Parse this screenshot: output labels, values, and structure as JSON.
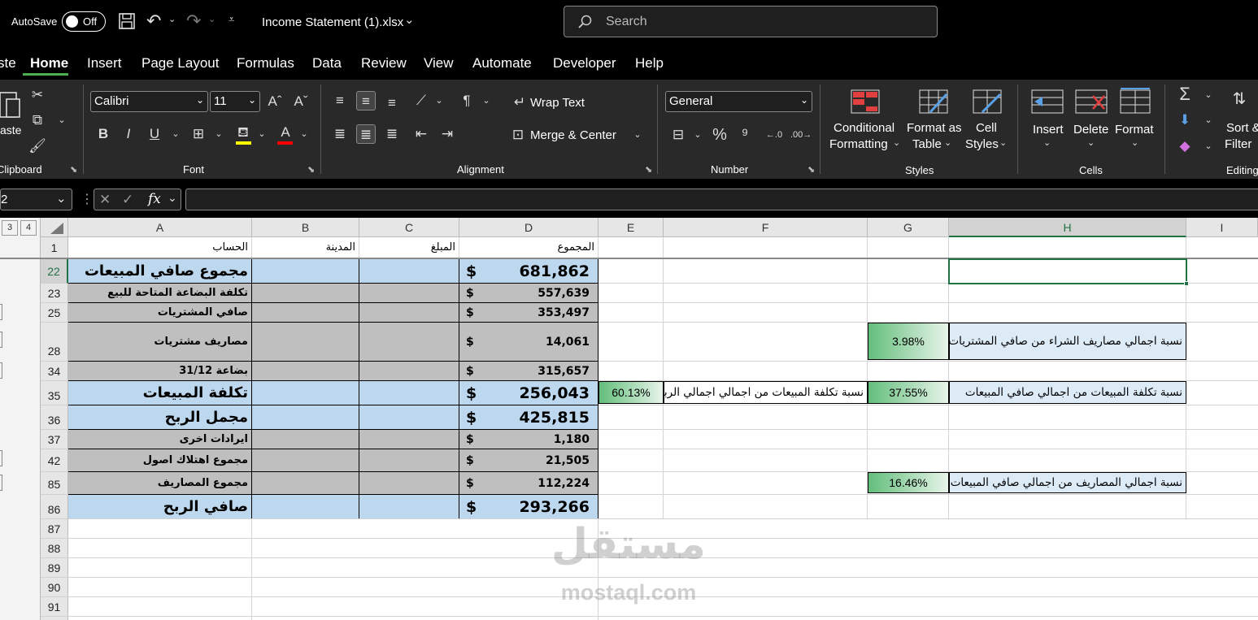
{
  "title_bar": {
    "autosave_label": "AutoSave",
    "autosave_state": "Off",
    "file_name": "Income Statement (1).xlsx",
    "search_placeholder": "Search"
  },
  "ribbon_tabs": [
    "ste",
    "Home",
    "Insert",
    "Page Layout",
    "Formulas",
    "Data",
    "Review",
    "View",
    "Automate",
    "Developer",
    "Help"
  ],
  "ribbon": {
    "clipboard": {
      "paste_label": "aste",
      "group_label": "Clipboard"
    },
    "font": {
      "name": "Calibri",
      "size": "11",
      "group_label": "Font"
    },
    "alignment": {
      "wrap_text": "Wrap Text",
      "merge_center": "Merge & Center",
      "group_label": "Alignment"
    },
    "number": {
      "format": "General",
      "group_label": "Number"
    },
    "styles": {
      "conditional_1": "Conditional",
      "conditional_2": "Formatting",
      "format_table_1": "Format as",
      "format_table_2": "Table",
      "cell_styles_1": "Cell",
      "cell_styles_2": "Styles",
      "group_label": "Styles"
    },
    "cells": {
      "insert": "Insert",
      "delete": "Delete",
      "format": "Format",
      "group_label": "Cells"
    },
    "editing": {
      "sort_1": "Sort &",
      "sort_2": "Filter",
      "group_label": "Editing"
    }
  },
  "formula_bar": {
    "name_box": "2",
    "fx": "fx",
    "content": ""
  },
  "outline_levels": [
    "3",
    "4"
  ],
  "columns": [
    "A",
    "B",
    "C",
    "D",
    "E",
    "F",
    "G",
    "H",
    "I"
  ],
  "header_row": {
    "num": "1",
    "a": "الحساب",
    "b": "المدينة",
    "c": "المبلغ",
    "d": "المجموع"
  },
  "currency": "$",
  "rows": [
    {
      "num": "22",
      "label": "مجموع صافي المبيعات",
      "value": "681,862"
    },
    {
      "num": "23",
      "label": "تكلفة البضاعة المتاحة للبيع",
      "value": "557,639"
    },
    {
      "num": "25",
      "label": "صافي المشتريات",
      "value": "353,497"
    },
    {
      "num": "28",
      "label": "مصاريف مشتريات",
      "value": "14,061"
    },
    {
      "num": "34",
      "label": "بضاعة 31/12",
      "value": "315,657"
    },
    {
      "num": "35",
      "label": "تكلفة المبيعات",
      "value": "256,043"
    },
    {
      "num": "36",
      "label": "مجمل الربح",
      "value": "425,815"
    },
    {
      "num": "37",
      "label": "ايرادات اخرى",
      "value": "1,180"
    },
    {
      "num": "42",
      "label": "مجموع اهتلاك اصول",
      "value": "21,505"
    },
    {
      "num": "85",
      "label": "مجموع المصاريف",
      "value": "112,224"
    },
    {
      "num": "86",
      "label": "صافي الربح",
      "value": "293,266"
    }
  ],
  "empty_rows": [
    "87",
    "88",
    "89",
    "90",
    "91"
  ],
  "ratios": {
    "purchases_label": "نسبة اجمالي مصاريف الشراء من صافي المشتريات",
    "purchases_value": "3.98%",
    "cogs_label": "نسبة تكلفة المبيعات من اجمالي صافي المبيعات",
    "cogs_value": "37.55%",
    "cogs_profit_label": "نسبة تكلفة المبيعات من اجمالي اجمالي الربح",
    "cogs_profit_value": "60.13%",
    "expenses_label": "نسبة اجمالي المصاريف من اجمالي صافي المبيعات",
    "expenses_value": "16.46%"
  },
  "watermark": {
    "arabic": "مستقل",
    "latin": "mostaql.com"
  },
  "colors": {
    "band_blue": "#bdd7ee",
    "band_gray": "#bfbfbf",
    "ratio_box": "#ddebf7",
    "selected": "#217346"
  }
}
